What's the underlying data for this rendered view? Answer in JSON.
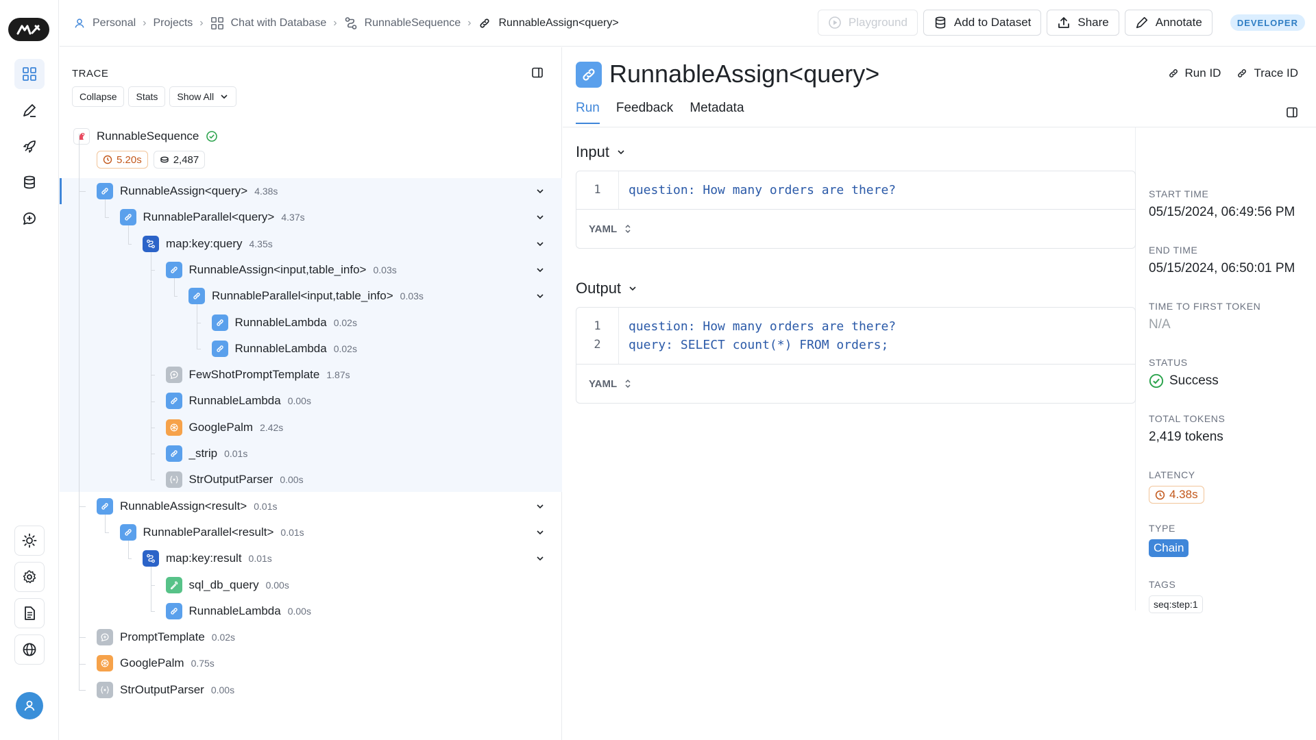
{
  "breadcrumb": [
    {
      "label": "Personal",
      "icon": "person-icon"
    },
    {
      "label": "Projects",
      "icon": ""
    },
    {
      "label": "Chat with Database",
      "icon": "grid-icon"
    },
    {
      "label": "RunnableSequence",
      "icon": "sequence-icon"
    },
    {
      "label": "RunnableAssign<query>",
      "icon": "link-icon"
    }
  ],
  "actions": {
    "playground": "Playground",
    "add_to_dataset": "Add to Dataset",
    "share": "Share",
    "annotate": "Annotate",
    "badge": "DEVELOPER"
  },
  "trace": {
    "title": "TRACE",
    "collapse": "Collapse",
    "stats": "Stats",
    "show_all": "Show All",
    "root": {
      "name": "RunnableSequence",
      "latency": "5.20s",
      "tokens": "2,487"
    },
    "nodes": [
      {
        "name": "RunnableAssign<query>",
        "dur": "4.38s",
        "depth": 0,
        "icon": "link",
        "color": "blue",
        "chevron": true
      },
      {
        "name": "RunnableParallel<query>",
        "dur": "4.37s",
        "depth": 1,
        "icon": "link",
        "color": "blue",
        "chevron": true
      },
      {
        "name": "map:key:query",
        "dur": "4.35s",
        "depth": 2,
        "icon": "map",
        "color": "navy",
        "chevron": true
      },
      {
        "name": "RunnableAssign<input,table_info>",
        "dur": "0.03s",
        "depth": 3,
        "icon": "link",
        "color": "blue",
        "chevron": true
      },
      {
        "name": "RunnableParallel<input,table_info>",
        "dur": "0.03s",
        "depth": 4,
        "icon": "link",
        "color": "blue",
        "chevron": true
      },
      {
        "name": "RunnableLambda",
        "dur": "0.02s",
        "depth": 5,
        "icon": "link",
        "color": "blue",
        "chevron": false
      },
      {
        "name": "RunnableLambda",
        "dur": "0.02s",
        "depth": 5,
        "icon": "link",
        "color": "blue",
        "chevron": false
      },
      {
        "name": "FewShotPromptTemplate",
        "dur": "1.87s",
        "depth": 3,
        "icon": "chat",
        "color": "gray",
        "chevron": false
      },
      {
        "name": "RunnableLambda",
        "dur": "0.00s",
        "depth": 3,
        "icon": "link",
        "color": "blue",
        "chevron": false
      },
      {
        "name": "GooglePalm",
        "dur": "2.42s",
        "depth": 3,
        "icon": "llm",
        "color": "orange",
        "chevron": false
      },
      {
        "name": "_strip",
        "dur": "0.01s",
        "depth": 3,
        "icon": "link",
        "color": "blue",
        "chevron": false
      },
      {
        "name": "StrOutputParser",
        "dur": "0.00s",
        "depth": 3,
        "icon": "parser",
        "color": "gray",
        "chevron": false
      },
      {
        "name": "RunnableAssign<result>",
        "dur": "0.01s",
        "depth": 0,
        "icon": "link",
        "color": "blue",
        "chevron": true
      },
      {
        "name": "RunnableParallel<result>",
        "dur": "0.01s",
        "depth": 1,
        "icon": "link",
        "color": "blue",
        "chevron": true
      },
      {
        "name": "map:key:result",
        "dur": "0.01s",
        "depth": 2,
        "icon": "map",
        "color": "navy",
        "chevron": true
      },
      {
        "name": "sql_db_query",
        "dur": "0.00s",
        "depth": 3,
        "icon": "tool",
        "color": "green",
        "chevron": false
      },
      {
        "name": "RunnableLambda",
        "dur": "0.00s",
        "depth": 3,
        "icon": "link",
        "color": "blue",
        "chevron": false
      },
      {
        "name": "PromptTemplate",
        "dur": "0.02s",
        "depth": 0,
        "icon": "chat",
        "color": "gray",
        "chevron": false
      },
      {
        "name": "GooglePalm",
        "dur": "0.75s",
        "depth": 0,
        "icon": "llm",
        "color": "orange",
        "chevron": false
      },
      {
        "name": "StrOutputParser",
        "dur": "0.00s",
        "depth": 0,
        "icon": "parser",
        "color": "gray",
        "chevron": false
      }
    ]
  },
  "detail": {
    "title": "RunnableAssign<query>",
    "run_id": "Run ID",
    "trace_id": "Trace ID",
    "tabs": [
      "Run",
      "Feedback",
      "Metadata"
    ],
    "input": {
      "label": "Input",
      "lines": [
        "question: How many orders are there?"
      ],
      "format": "YAML"
    },
    "output": {
      "label": "Output",
      "lines": [
        "question: How many orders are there?",
        "query: SELECT count(*) FROM orders;"
      ],
      "format": "YAML"
    }
  },
  "meta": {
    "start_time": {
      "label": "START TIME",
      "value": "05/15/2024, 06:49:56 PM"
    },
    "end_time": {
      "label": "END TIME",
      "value": "05/15/2024, 06:50:01 PM"
    },
    "ttft": {
      "label": "TIME TO FIRST TOKEN",
      "value": "N/A"
    },
    "status": {
      "label": "STATUS",
      "value": "Success"
    },
    "total_tokens": {
      "label": "TOTAL TOKENS",
      "value": "2,419 tokens"
    },
    "latency": {
      "label": "LATENCY",
      "value": "4.38s"
    },
    "type": {
      "label": "TYPE",
      "value": "Chain"
    },
    "tags": {
      "label": "TAGS",
      "value": "seq:step:1"
    }
  },
  "colors": {
    "accent": "#3f86d9",
    "link_icon": "#5aa0ec",
    "map_icon": "#2b63c8",
    "llm_icon": "#f6a24a",
    "tool_icon": "#57c288",
    "gray_icon": "#b9c0c8",
    "success": "#2da44e",
    "latency": "#c2571a"
  }
}
